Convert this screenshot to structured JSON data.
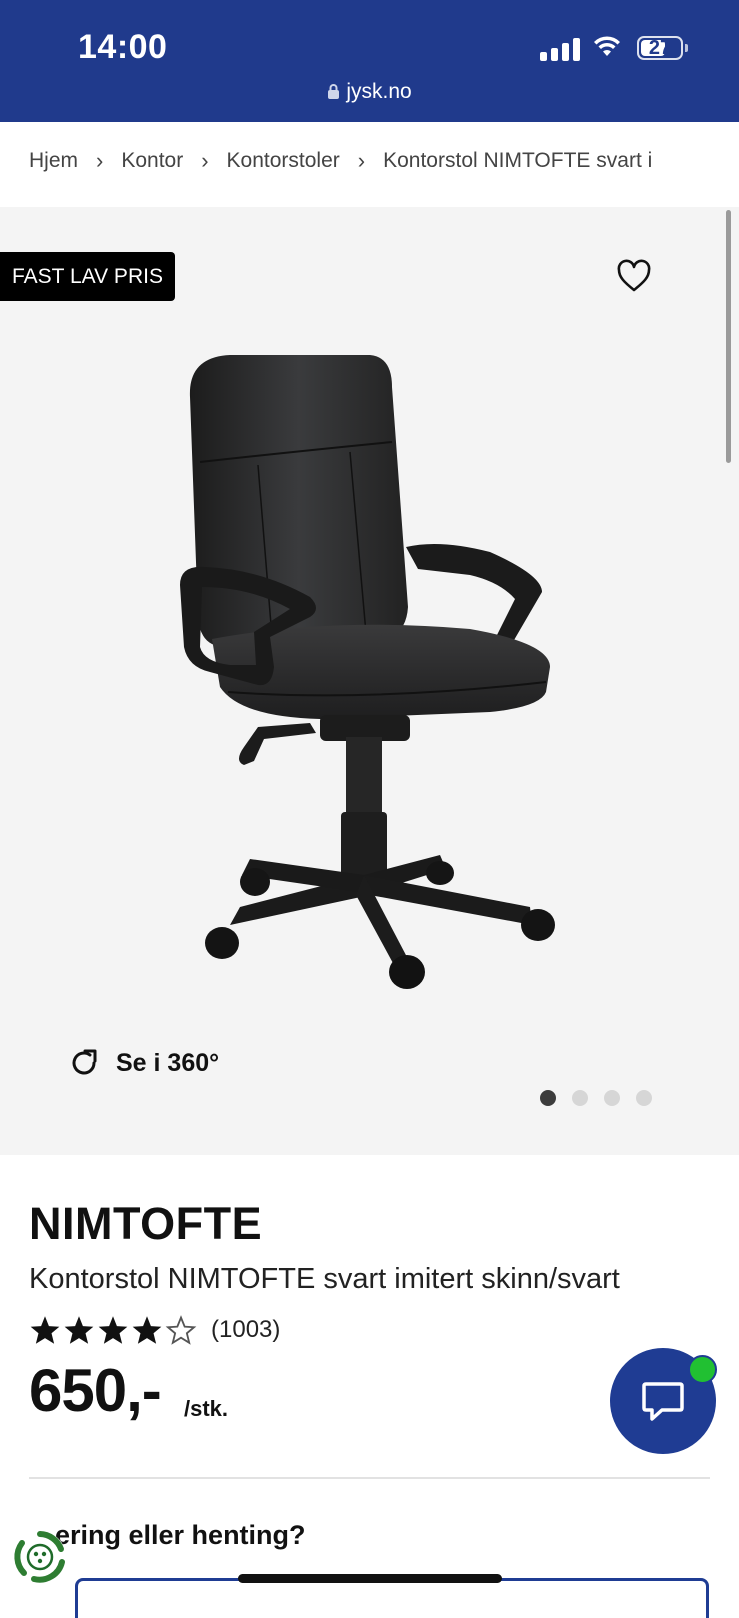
{
  "status_bar": {
    "time": "14:00",
    "battery": "27",
    "url": "jysk.no"
  },
  "breadcrumb": {
    "items": [
      "Hjem",
      "Kontor",
      "Kontorstoler",
      "Kontorstol NIMTOFTE svart i"
    ]
  },
  "gallery": {
    "badge": "FAST LAV PRIS",
    "view360_label": "Se i 360°",
    "image_count": 4,
    "active_image": 1
  },
  "product": {
    "brand": "NIMTOFTE",
    "name": "Kontorstol NIMTOFTE svart imitert skinn/svart",
    "rating": 4,
    "rating_max": 5,
    "review_count": "(1003)",
    "price": "650,-",
    "unit": "/stk."
  },
  "delivery": {
    "heading": "ering eller henting?"
  },
  "colors": {
    "brand_blue": "#203a8c",
    "chat_blue": "#1f3c93",
    "online_green": "#21c032"
  }
}
